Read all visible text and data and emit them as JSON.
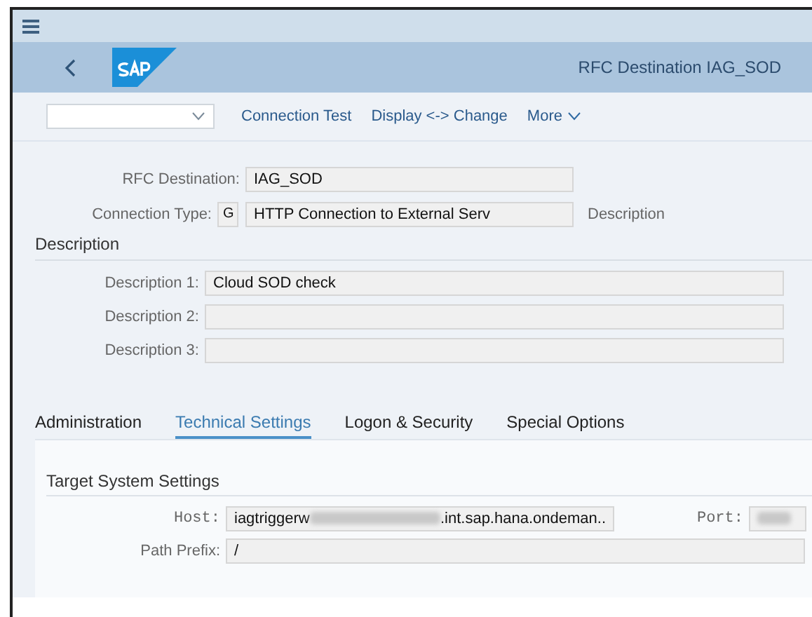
{
  "shell": {
    "title": "RFC Destination IAG_SOD"
  },
  "toolbar": {
    "buttons": [
      {
        "label": "Connection Test"
      },
      {
        "label": "Display <-> Change"
      },
      {
        "label": "More",
        "kind": "menu"
      }
    ]
  },
  "header_fields": {
    "rfc_destination": {
      "label": "RFC Destination:",
      "value": "IAG_SOD"
    },
    "connection_type": {
      "label": "Connection Type:",
      "code": "G",
      "value": "HTTP Connection to External Serv",
      "note": "Description"
    }
  },
  "description": {
    "title": "Description",
    "fields": [
      {
        "label": "Description 1:",
        "value": "Cloud SOD check"
      },
      {
        "label": "Description 2:"
      },
      {
        "label": "Description 3:"
      }
    ]
  },
  "tabs": [
    {
      "label": "Administration",
      "selected": false
    },
    {
      "label": "Technical Settings",
      "selected": true
    },
    {
      "label": "Logon & Security",
      "selected": false
    },
    {
      "label": "Special Options",
      "selected": false
    }
  ],
  "target_system": {
    "title": "Target System Settings",
    "host": {
      "label": "Host:",
      "value_start": "iagtriggerw",
      "value_end": ".int.sap.hana.ondeman..",
      "redacted": true
    },
    "port": {
      "label": "Port:",
      "redacted": true
    },
    "path_prefix": {
      "label": "Path Prefix:",
      "value": "/"
    }
  }
}
